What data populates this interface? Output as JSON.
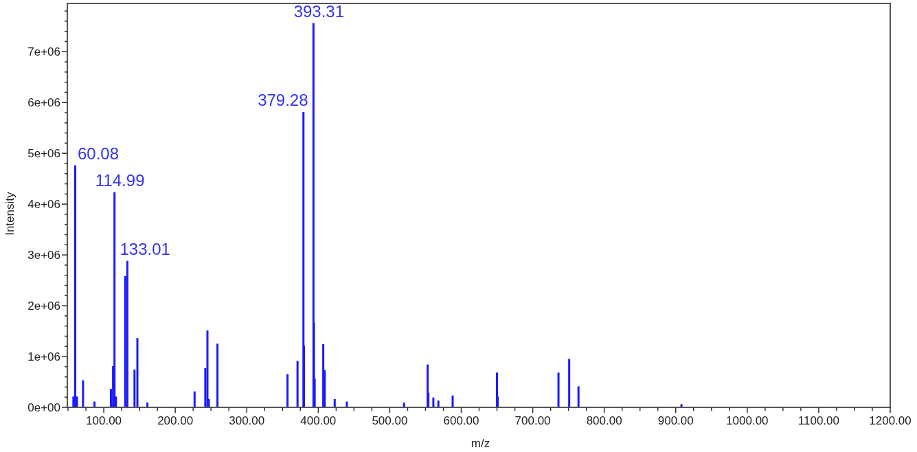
{
  "chart_data": {
    "type": "bar",
    "xlabel": "m/z",
    "ylabel": "Intensity",
    "x": [
      57.5,
      60.08,
      62.5,
      71,
      87,
      110,
      113,
      114.99,
      117,
      130,
      133.01,
      143,
      147,
      161,
      227,
      242,
      245,
      247,
      259,
      357,
      371,
      379.28,
      380,
      393.31,
      394,
      395,
      407,
      409,
      423,
      440,
      520,
      553,
      554,
      561,
      568,
      588,
      650,
      651,
      736,
      751,
      764,
      908
    ],
    "values": [
      200000,
      4750000,
      200000,
      520000,
      100000,
      350000,
      800000,
      4220000,
      200000,
      2570000,
      2870000,
      730000,
      1350000,
      80000,
      300000,
      760000,
      1500000,
      150000,
      1240000,
      640000,
      900000,
      5800000,
      1200000,
      7550000,
      1650000,
      550000,
      1230000,
      720000,
      150000,
      100000,
      80000,
      830000,
      270000,
      180000,
      120000,
      220000,
      670000,
      200000,
      670000,
      940000,
      400000,
      50000
    ],
    "xlim": [
      49,
      1200
    ],
    "ylim": [
      0,
      7950000
    ],
    "xticks": [
      {
        "value": 100,
        "label": "100.00"
      },
      {
        "value": 200,
        "label": "200.00"
      },
      {
        "value": 300,
        "label": "300.00"
      },
      {
        "value": 400,
        "label": "400.00"
      },
      {
        "value": 500,
        "label": "500.00"
      },
      {
        "value": 600,
        "label": "600.00"
      },
      {
        "value": 700,
        "label": "700.00"
      },
      {
        "value": 800,
        "label": "800.00"
      },
      {
        "value": 900,
        "label": "900.00"
      },
      {
        "value": 1000,
        "label": "1000.00"
      },
      {
        "value": 1100,
        "label": "1100.00"
      },
      {
        "value": 1200,
        "label": "1200.00"
      }
    ],
    "yticks": [
      {
        "value": 0,
        "label": "0e+00"
      },
      {
        "value": 1000000,
        "label": "1e+06"
      },
      {
        "value": 2000000,
        "label": "2e+06"
      },
      {
        "value": 3000000,
        "label": "3e+06"
      },
      {
        "value": 4000000,
        "label": "4e+06"
      },
      {
        "value": 5000000,
        "label": "5e+06"
      },
      {
        "value": 6000000,
        "label": "6e+06"
      },
      {
        "value": 7000000,
        "label": "7e+06"
      }
    ],
    "annotations": [
      {
        "x": 60.08,
        "y": 4750000,
        "text": "60.08"
      },
      {
        "x": 114.99,
        "y": 4220000,
        "text": "114.99"
      },
      {
        "x": 133.01,
        "y": 2870000,
        "text": "133.01"
      },
      {
        "x": 379.28,
        "y": 5800000,
        "text": "379.28"
      },
      {
        "x": 393.31,
        "y": 7550000,
        "text": "393.31"
      }
    ]
  }
}
